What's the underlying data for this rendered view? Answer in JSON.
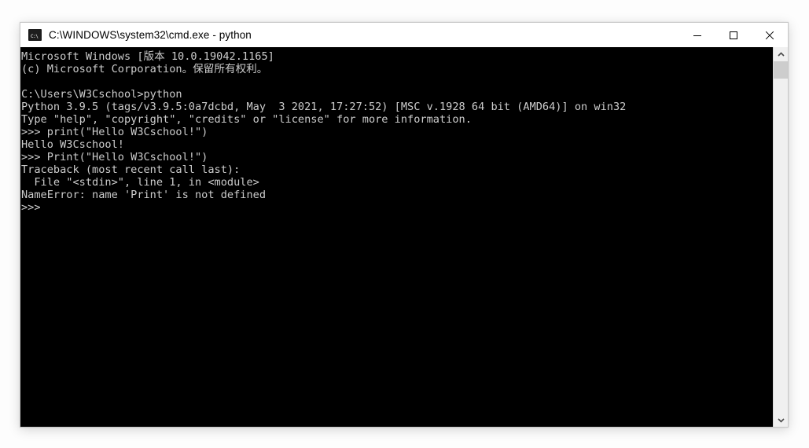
{
  "window": {
    "title": "C:\\WINDOWS\\system32\\cmd.exe - python",
    "icon": "cmd-console-icon",
    "icon_glyph": "C:\\",
    "controls": {
      "minimize_label": "Minimize",
      "maximize_label": "Maximize",
      "close_label": "Close"
    }
  },
  "terminal": {
    "background_color": "#000000",
    "text_color": "#cccccc",
    "lines": [
      "Microsoft Windows [版本 10.0.19042.1165]",
      "(c) Microsoft Corporation。保留所有权利。",
      "",
      "C:\\Users\\W3Cschool>python",
      "Python 3.9.5 (tags/v3.9.5:0a7dcbd, May  3 2021, 17:27:52) [MSC v.1928 64 bit (AMD64)] on win32",
      "Type \"help\", \"copyright\", \"credits\" or \"license\" for more information.",
      ">>> print(\"Hello W3Cschool!\")",
      "Hello W3Cschool!",
      ">>> Print(\"Hello W3Cschool!\")",
      "Traceback (most recent call last):",
      "  File \"<stdin>\", line 1, in <module>",
      "NameError: name 'Print' is not defined",
      ">>>"
    ]
  },
  "scrollbar": {
    "up_arrow_label": "Scroll up",
    "down_arrow_label": "Scroll down",
    "thumb_label": "Scroll thumb"
  }
}
